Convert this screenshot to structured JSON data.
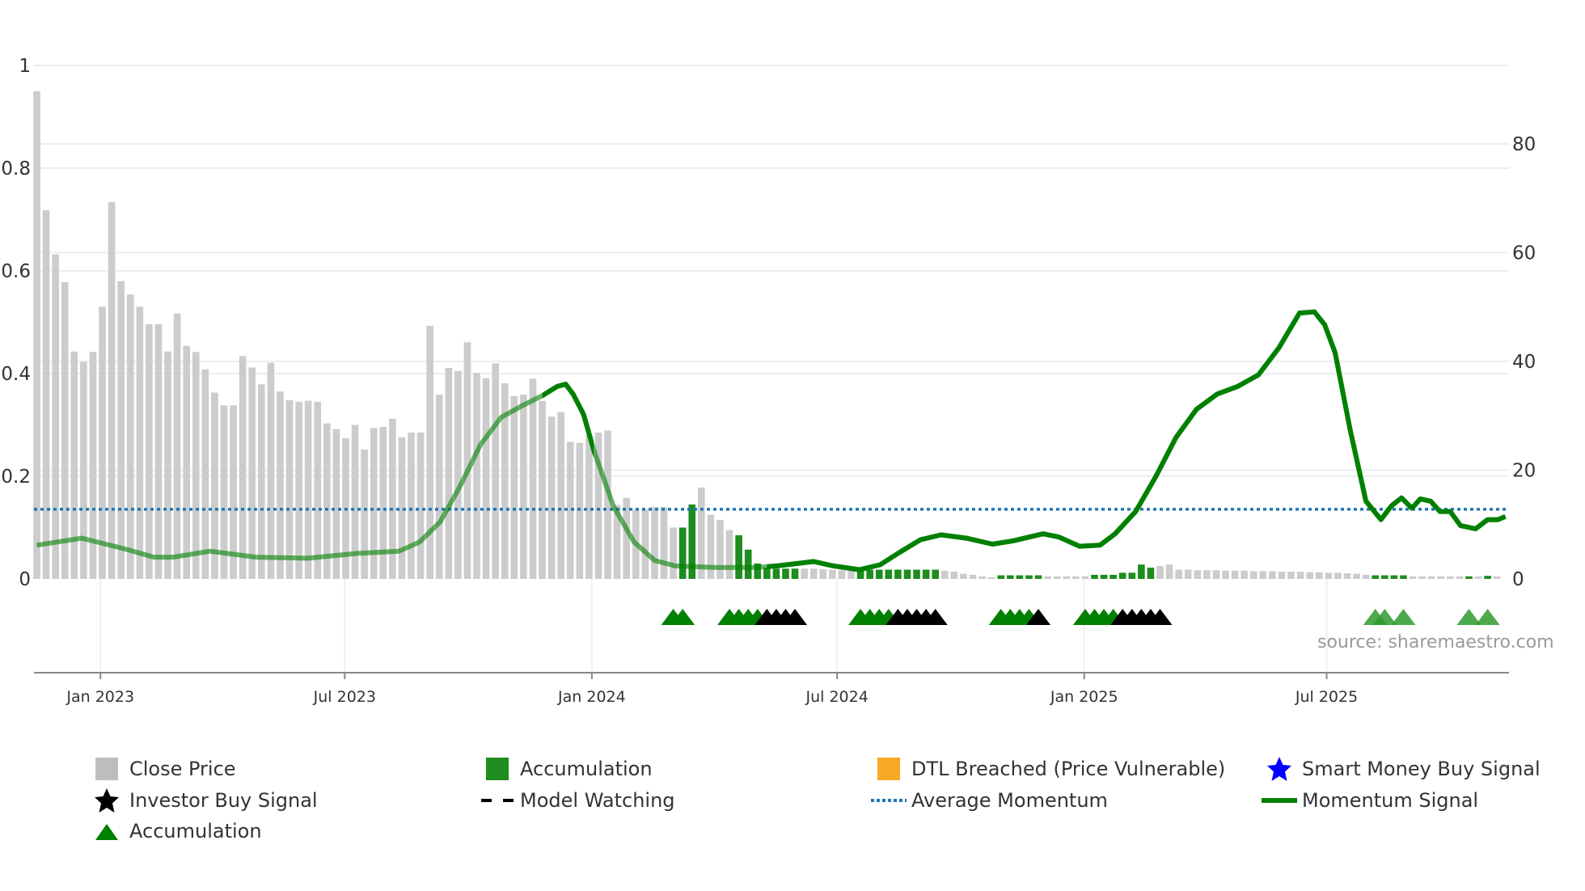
{
  "chart_data": {
    "type": "bar+line",
    "x_unit": "week index (weekly bars from Dec 2022 to Oct 2025)",
    "x_ticks": [
      {
        "label": "Jan 2023",
        "week": 6.8
      },
      {
        "label": "Jul 2023",
        "week": 32.9
      },
      {
        "label": "Jan 2024",
        "week": 59.3
      },
      {
        "label": "Jul 2024",
        "week": 85.5
      },
      {
        "label": "Jan 2025",
        "week": 111.9
      },
      {
        "label": "Jul 2025",
        "week": 137.8
      }
    ],
    "left_axis": {
      "range": [
        0,
        1
      ],
      "ticks": [
        "0",
        "0.2",
        "0.4",
        "0.6",
        "0.8",
        "1"
      ],
      "tick_values": [
        0,
        0.2,
        0.4,
        0.6,
        0.8,
        1
      ]
    },
    "right_axis": {
      "range": [
        0,
        80
      ],
      "ticks": [
        "0",
        "20",
        "40",
        "60",
        "80"
      ],
      "tick_values": [
        0,
        20,
        40,
        60,
        80
      ]
    },
    "bars": {
      "values": [
        0.95,
        0.718,
        0.632,
        0.578,
        0.443,
        0.423,
        0.442,
        0.53,
        0.734,
        0.58,
        0.554,
        0.53,
        0.496,
        0.496,
        0.443,
        0.517,
        0.454,
        0.442,
        0.408,
        0.363,
        0.338,
        0.338,
        0.434,
        0.412,
        0.379,
        0.421,
        0.365,
        0.348,
        0.345,
        0.347,
        0.345,
        0.303,
        0.292,
        0.274,
        0.3,
        0.252,
        0.294,
        0.296,
        0.312,
        0.276,
        0.285,
        0.285,
        0.493,
        0.359,
        0.411,
        0.405,
        0.461,
        0.401,
        0.391,
        0.42,
        0.381,
        0.356,
        0.359,
        0.39,
        0.347,
        0.316,
        0.325,
        0.267,
        0.265,
        0.28,
        0.285,
        0.289,
        0.144,
        0.158,
        0.135,
        0.135,
        0.14,
        0.14,
        0.1,
        0.1,
        0.145,
        0.178,
        0.125,
        0.115,
        0.095,
        0.085,
        0.057,
        0.03,
        0.022,
        0.02,
        0.02,
        0.02,
        0.02,
        0.02,
        0.019,
        0.018,
        0.017,
        0.016,
        0.018,
        0.018,
        0.018,
        0.018,
        0.018,
        0.018,
        0.018,
        0.018,
        0.018,
        0.016,
        0.014,
        0.01,
        0.008,
        0.005,
        0.003,
        0.007,
        0.007,
        0.007,
        0.007,
        0.007,
        0.005,
        0.005,
        0.005,
        0.005,
        0.005,
        0.008,
        0.008,
        0.008,
        0.012,
        0.012,
        0.028,
        0.022,
        0.025,
        0.028,
        0.018,
        0.018,
        0.017,
        0.017,
        0.017,
        0.016,
        0.016,
        0.016,
        0.015,
        0.015,
        0.015,
        0.014,
        0.014,
        0.014,
        0.013,
        0.013,
        0.012,
        0.012,
        0.011,
        0.01,
        0.008,
        0.007,
        0.007,
        0.007,
        0.007,
        0.005,
        0.005,
        0.005,
        0.005,
        0.005,
        0.005,
        0.005,
        0.005,
        0.006,
        0.005
      ],
      "accumulation_weeks": [
        69,
        70,
        75,
        76,
        77,
        78,
        79,
        80,
        81,
        88,
        89,
        90,
        91,
        92,
        93,
        94,
        95,
        96,
        103,
        104,
        105,
        106,
        107,
        113,
        114,
        115,
        116,
        117,
        118,
        119,
        143,
        144,
        145,
        146,
        153,
        155
      ]
    },
    "momentum": {
      "points": [
        [
          0,
          6.2
        ],
        [
          4.8,
          7.5
        ],
        [
          9.2,
          5.6
        ],
        [
          12.5,
          4
        ],
        [
          14.6,
          4
        ],
        [
          18.5,
          5.1
        ],
        [
          23.4,
          4
        ],
        [
          28.9,
          3.8
        ],
        [
          34.3,
          4.7
        ],
        [
          38.7,
          5.1
        ],
        [
          40.9,
          6.8
        ],
        [
          43.1,
          10.5
        ],
        [
          45.2,
          17
        ],
        [
          47.4,
          24.7
        ],
        [
          49.6,
          29.7
        ],
        [
          51.8,
          31.8
        ],
        [
          54,
          33.7
        ],
        [
          55.6,
          35.4
        ],
        [
          56.5,
          35.8
        ],
        [
          57.3,
          34
        ],
        [
          58.4,
          30.3
        ],
        [
          59.5,
          23.7
        ],
        [
          61.6,
          13.4
        ],
        [
          63.8,
          6.8
        ],
        [
          66,
          3.4
        ],
        [
          68.2,
          2.4
        ],
        [
          72.6,
          2.1
        ],
        [
          76.9,
          2.1
        ],
        [
          79.1,
          2.4
        ],
        [
          83,
          3.2
        ],
        [
          85.1,
          2.4
        ],
        [
          87.9,
          1.7
        ],
        [
          90.1,
          2.6
        ],
        [
          92.2,
          4.9
        ],
        [
          94.4,
          7.2
        ],
        [
          96.6,
          8.1
        ],
        [
          99.3,
          7.5
        ],
        [
          102.1,
          6.4
        ],
        [
          104.3,
          7
        ],
        [
          107.5,
          8.3
        ],
        [
          109.2,
          7.7
        ],
        [
          111.4,
          6
        ],
        [
          113.6,
          6.2
        ],
        [
          115.2,
          8.3
        ],
        [
          117.4,
          12.4
        ],
        [
          119.6,
          19
        ],
        [
          121.7,
          26
        ],
        [
          123.9,
          31.2
        ],
        [
          126.1,
          34
        ],
        [
          128.3,
          35.4
        ],
        [
          130.5,
          37.5
        ],
        [
          132.7,
          42.5
        ],
        [
          134.9,
          48.9
        ],
        [
          136.5,
          49.1
        ],
        [
          137.6,
          46.7
        ],
        [
          138.7,
          41.6
        ],
        [
          140.3,
          27.5
        ],
        [
          142,
          14.3
        ],
        [
          143.6,
          10.9
        ],
        [
          144.7,
          13.4
        ],
        [
          145.8,
          14.9
        ],
        [
          146.9,
          13
        ],
        [
          147.8,
          14.7
        ],
        [
          148.9,
          14.3
        ],
        [
          149.9,
          12.4
        ],
        [
          151,
          12.4
        ],
        [
          152.1,
          9.8
        ],
        [
          153.7,
          9.2
        ],
        [
          155,
          10.9
        ],
        [
          156.1,
          10.9
        ],
        [
          156.9,
          11.5
        ]
      ],
      "active_ranges": [
        [
          54,
          59.5
        ],
        [
          78,
          157
        ]
      ]
    },
    "average_momentum": 12.8,
    "signals": [
      {
        "type": "accumulation",
        "weeks": [
          68,
          69
        ]
      },
      {
        "type": "accumulation",
        "weeks": [
          74,
          75,
          76,
          77
        ]
      },
      {
        "type": "investor_buy",
        "weeks": [
          78,
          79,
          80,
          81
        ]
      },
      {
        "type": "accumulation",
        "weeks": [
          88,
          89,
          90,
          91
        ]
      },
      {
        "type": "investor_buy",
        "weeks": [
          92,
          93,
          94,
          95,
          96
        ]
      },
      {
        "type": "accumulation",
        "weeks": [
          103,
          104,
          105,
          106
        ]
      },
      {
        "type": "investor_buy",
        "weeks": [
          107
        ]
      },
      {
        "type": "accumulation",
        "weeks": [
          112,
          113,
          114,
          115
        ]
      },
      {
        "type": "investor_buy",
        "weeks": [
          116,
          117,
          118,
          119,
          120
        ]
      },
      {
        "type": "accumulation_faded",
        "weeks": [
          143,
          144,
          146
        ]
      },
      {
        "type": "accumulation_faded",
        "weeks": [
          153,
          155
        ]
      }
    ],
    "source": "source: sharemaestro.com",
    "legend": [
      {
        "label": "Close Price",
        "marker": "square",
        "color": "#bdbdbd"
      },
      {
        "label": "Accumulation",
        "marker": "square",
        "color": "#1e8c1e"
      },
      {
        "label": "DTL Breached (Price Vulnerable)",
        "marker": "square",
        "color": "#f9a825"
      },
      {
        "label": "Smart Money Buy Signal",
        "marker": "star",
        "color": "#0000ff"
      },
      {
        "label": "Investor Buy Signal",
        "marker": "star",
        "color": "#000000"
      },
      {
        "label": "Model Watching",
        "marker": "dash",
        "color": "#000000"
      },
      {
        "label": "Average Momentum",
        "marker": "dot",
        "color": "#1f77b4"
      },
      {
        "label": "Momentum Signal",
        "marker": "line",
        "color": "#008000"
      },
      {
        "label": "Accumulation",
        "marker": "triangle",
        "color": "#008000"
      }
    ],
    "colors": {
      "close": "#cccccc",
      "accumulation": "#1e8c1e",
      "momentum": "#008000",
      "average": "#1f77b4",
      "investor": "#000000",
      "grid": "#ebedf0"
    }
  }
}
